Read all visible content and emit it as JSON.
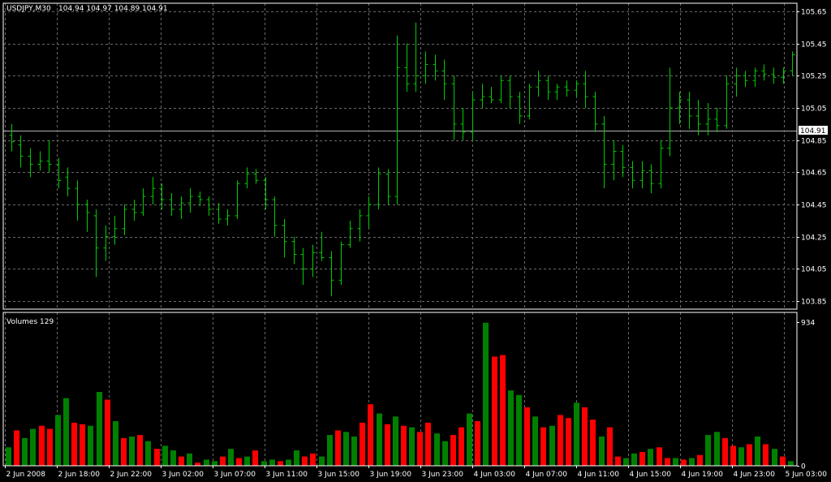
{
  "chart_data": [
    {
      "type": "ohlc",
      "title": "USDJPY,M30",
      "ohlc_header": "104.94 104.97 104.89 104.91",
      "current_price": 104.91,
      "current_price_label": "104.91",
      "ylim": [
        103.8,
        105.7
      ],
      "y_ticks": [
        "105.65",
        "105.45",
        "105.25",
        "105.05",
        "104.85",
        "104.65",
        "104.45",
        "104.25",
        "104.05",
        "103.85"
      ],
      "grid": true,
      "bar_color": "#00cc00",
      "bars": [
        {
          "o": 104.88,
          "h": 104.95,
          "l": 104.78,
          "c": 104.84
        },
        {
          "o": 104.82,
          "h": 104.88,
          "l": 104.68,
          "c": 104.75
        },
        {
          "o": 104.75,
          "h": 104.8,
          "l": 104.62,
          "c": 104.7
        },
        {
          "o": 104.7,
          "h": 104.78,
          "l": 104.66,
          "c": 104.72
        },
        {
          "o": 104.72,
          "h": 104.85,
          "l": 104.65,
          "c": 104.7
        },
        {
          "o": 104.7,
          "h": 104.74,
          "l": 104.55,
          "c": 104.6
        },
        {
          "o": 104.62,
          "h": 104.68,
          "l": 104.5,
          "c": 104.55
        },
        {
          "o": 104.55,
          "h": 104.6,
          "l": 104.35,
          "c": 104.45
        },
        {
          "o": 104.45,
          "h": 104.48,
          "l": 104.28,
          "c": 104.4
        },
        {
          "o": 104.38,
          "h": 104.42,
          "l": 104.0,
          "c": 104.18
        },
        {
          "o": 104.18,
          "h": 104.32,
          "l": 104.1,
          "c": 104.25
        },
        {
          "o": 104.25,
          "h": 104.38,
          "l": 104.2,
          "c": 104.3
        },
        {
          "o": 104.3,
          "h": 104.45,
          "l": 104.26,
          "c": 104.42
        },
        {
          "o": 104.42,
          "h": 104.48,
          "l": 104.35,
          "c": 104.4
        },
        {
          "o": 104.4,
          "h": 104.55,
          "l": 104.38,
          "c": 104.5
        },
        {
          "o": 104.5,
          "h": 104.62,
          "l": 104.45,
          "c": 104.55
        },
        {
          "o": 104.55,
          "h": 104.58,
          "l": 104.42,
          "c": 104.48
        },
        {
          "o": 104.48,
          "h": 104.52,
          "l": 104.38,
          "c": 104.42
        },
        {
          "o": 104.42,
          "h": 104.5,
          "l": 104.36,
          "c": 104.46
        },
        {
          "o": 104.46,
          "h": 104.55,
          "l": 104.4,
          "c": 104.5
        },
        {
          "o": 104.5,
          "h": 104.53,
          "l": 104.44,
          "c": 104.48
        },
        {
          "o": 104.48,
          "h": 104.5,
          "l": 104.38,
          "c": 104.42
        },
        {
          "o": 104.42,
          "h": 104.46,
          "l": 104.33,
          "c": 104.36
        },
        {
          "o": 104.36,
          "h": 104.42,
          "l": 104.32,
          "c": 104.38
        },
        {
          "o": 104.38,
          "h": 104.6,
          "l": 104.36,
          "c": 104.58
        },
        {
          "o": 104.58,
          "h": 104.68,
          "l": 104.55,
          "c": 104.64
        },
        {
          "o": 104.64,
          "h": 104.67,
          "l": 104.58,
          "c": 104.6
        },
        {
          "o": 104.6,
          "h": 104.62,
          "l": 104.42,
          "c": 104.48
        },
        {
          "o": 104.48,
          "h": 104.5,
          "l": 104.25,
          "c": 104.32
        },
        {
          "o": 104.32,
          "h": 104.36,
          "l": 104.12,
          "c": 104.22
        },
        {
          "o": 104.22,
          "h": 104.25,
          "l": 104.08,
          "c": 104.14
        },
        {
          "o": 104.14,
          "h": 104.18,
          "l": 103.95,
          "c": 104.05
        },
        {
          "o": 104.05,
          "h": 104.2,
          "l": 104.0,
          "c": 104.15
        },
        {
          "o": 104.15,
          "h": 104.28,
          "l": 104.1,
          "c": 104.12
        },
        {
          "o": 104.12,
          "h": 104.16,
          "l": 103.88,
          "c": 103.98
        },
        {
          "o": 103.98,
          "h": 104.22,
          "l": 103.95,
          "c": 104.2
        },
        {
          "o": 104.2,
          "h": 104.35,
          "l": 104.18,
          "c": 104.3
        },
        {
          "o": 104.3,
          "h": 104.42,
          "l": 104.22,
          "c": 104.38
        },
        {
          "o": 104.38,
          "h": 104.5,
          "l": 104.3,
          "c": 104.45
        },
        {
          "o": 104.45,
          "h": 104.68,
          "l": 104.42,
          "c": 104.64
        },
        {
          "o": 104.64,
          "h": 104.67,
          "l": 104.45,
          "c": 104.5
        },
        {
          "o": 104.5,
          "h": 105.5,
          "l": 104.45,
          "c": 105.3
        },
        {
          "o": 105.3,
          "h": 105.45,
          "l": 105.15,
          "c": 105.2
        },
        {
          "o": 105.2,
          "h": 105.58,
          "l": 105.15,
          "c": 105.25
        },
        {
          "o": 105.25,
          "h": 105.4,
          "l": 105.2,
          "c": 105.32
        },
        {
          "o": 105.32,
          "h": 105.38,
          "l": 105.22,
          "c": 105.28
        },
        {
          "o": 105.28,
          "h": 105.35,
          "l": 105.1,
          "c": 105.2
        },
        {
          "o": 105.2,
          "h": 105.25,
          "l": 104.85,
          "c": 104.95
        },
        {
          "o": 104.95,
          "h": 105.05,
          "l": 104.85,
          "c": 104.9
        },
        {
          "o": 104.9,
          "h": 105.15,
          "l": 104.85,
          "c": 105.1
        },
        {
          "o": 105.1,
          "h": 105.2,
          "l": 105.05,
          "c": 105.12
        },
        {
          "o": 105.12,
          "h": 105.18,
          "l": 105.08,
          "c": 105.1
        },
        {
          "o": 105.1,
          "h": 105.25,
          "l": 105.08,
          "c": 105.22
        },
        {
          "o": 105.22,
          "h": 105.25,
          "l": 105.05,
          "c": 105.12
        },
        {
          "o": 105.12,
          "h": 105.15,
          "l": 104.95,
          "c": 105.0
        },
        {
          "o": 105.0,
          "h": 105.2,
          "l": 104.98,
          "c": 105.18
        },
        {
          "o": 105.18,
          "h": 105.28,
          "l": 105.12,
          "c": 105.22
        },
        {
          "o": 105.22,
          "h": 105.25,
          "l": 105.1,
          "c": 105.15
        },
        {
          "o": 105.15,
          "h": 105.2,
          "l": 105.1,
          "c": 105.18
        },
        {
          "o": 105.18,
          "h": 105.22,
          "l": 105.12,
          "c": 105.16
        },
        {
          "o": 105.16,
          "h": 105.22,
          "l": 105.12,
          "c": 105.2
        },
        {
          "o": 105.2,
          "h": 105.28,
          "l": 105.05,
          "c": 105.12
        },
        {
          "o": 105.12,
          "h": 105.15,
          "l": 104.9,
          "c": 104.95
        },
        {
          "o": 104.95,
          "h": 105.0,
          "l": 104.55,
          "c": 104.7
        },
        {
          "o": 104.7,
          "h": 104.85,
          "l": 104.6,
          "c": 104.78
        },
        {
          "o": 104.78,
          "h": 104.82,
          "l": 104.62,
          "c": 104.68
        },
        {
          "o": 104.68,
          "h": 104.72,
          "l": 104.55,
          "c": 104.6
        },
        {
          "o": 104.6,
          "h": 104.72,
          "l": 104.55,
          "c": 104.66
        },
        {
          "o": 104.66,
          "h": 104.7,
          "l": 104.52,
          "c": 104.58
        },
        {
          "o": 104.58,
          "h": 104.85,
          "l": 104.55,
          "c": 104.8
        },
        {
          "o": 104.8,
          "h": 105.3,
          "l": 104.75,
          "c": 105.05
        },
        {
          "o": 105.05,
          "h": 105.15,
          "l": 104.95,
          "c": 105.1
        },
        {
          "o": 105.1,
          "h": 105.15,
          "l": 104.92,
          "c": 105.0
        },
        {
          "o": 105.0,
          "h": 105.1,
          "l": 104.88,
          "c": 104.95
        },
        {
          "o": 104.95,
          "h": 105.08,
          "l": 104.88,
          "c": 104.98
        },
        {
          "o": 104.98,
          "h": 105.05,
          "l": 104.9,
          "c": 104.94
        },
        {
          "o": 104.94,
          "h": 105.25,
          "l": 104.92,
          "c": 105.2
        },
        {
          "o": 105.2,
          "h": 105.3,
          "l": 105.12,
          "c": 105.25
        },
        {
          "o": 105.25,
          "h": 105.28,
          "l": 105.18,
          "c": 105.22
        },
        {
          "o": 105.22,
          "h": 105.3,
          "l": 105.18,
          "c": 105.28
        },
        {
          "o": 105.28,
          "h": 105.32,
          "l": 105.22,
          "c": 105.26
        },
        {
          "o": 105.26,
          "h": 105.3,
          "l": 105.2,
          "c": 105.24
        },
        {
          "o": 105.24,
          "h": 105.3,
          "l": 105.2,
          "c": 105.28
        },
        {
          "o": 105.28,
          "h": 105.4,
          "l": 105.25,
          "c": 105.38
        }
      ]
    },
    {
      "type": "bar",
      "title": "Volumes 129",
      "ylim": [
        0,
        934
      ],
      "y_ticks": [
        "934",
        "0"
      ],
      "up_color": "#008000",
      "down_color": "#ff0000",
      "x_tick_labels": [
        "2 Jun 2008",
        "2 Jun 18:00",
        "2 Jun 22:00",
        "3 Jun 02:00",
        "3 Jun 07:00",
        "3 Jun 11:00",
        "3 Jun 15:00",
        "3 Jun 19:00",
        "3 Jun 23:00",
        "4 Jun 03:00",
        "4 Jun 07:00",
        "4 Jun 11:00",
        "4 Jun 15:00",
        "4 Jun 19:00",
        "4 Jun 23:00",
        "5 Jun 03:00"
      ],
      "volumes": [
        120,
        230,
        180,
        240,
        260,
        240,
        330,
        440,
        280,
        270,
        260,
        480,
        430,
        290,
        180,
        190,
        200,
        160,
        110,
        130,
        100,
        60,
        80,
        20,
        40,
        30,
        60,
        110,
        50,
        60,
        100,
        30,
        40,
        30,
        40,
        100,
        60,
        80,
        60,
        200,
        230,
        220,
        190,
        280,
        400,
        340,
        270,
        320,
        260,
        250,
        220,
        280,
        210,
        160,
        200,
        250,
        340,
        290,
        930,
        710,
        720,
        490,
        460,
        380,
        320,
        250,
        260,
        330,
        310,
        410,
        380,
        300,
        190,
        250,
        60,
        50,
        80,
        90,
        110,
        120,
        50,
        50,
        40,
        50,
        70,
        200,
        220,
        180,
        130,
        120,
        140,
        190,
        140,
        110,
        60,
        30
      ],
      "volume_colors": [
        "g",
        "r",
        "g",
        "g",
        "r",
        "r",
        "g",
        "g",
        "r",
        "r",
        "g",
        "g",
        "r",
        "g",
        "r",
        "g",
        "r",
        "g",
        "r",
        "g",
        "g",
        "r",
        "g",
        "r",
        "g",
        "g",
        "r",
        "g",
        "r",
        "g",
        "r",
        "g",
        "g",
        "r",
        "g",
        "g",
        "r",
        "r",
        "g",
        "g",
        "r",
        "g",
        "g",
        "r",
        "r",
        "g",
        "r",
        "g",
        "r",
        "g",
        "r",
        "r",
        "g",
        "g",
        "r",
        "r",
        "g",
        "r",
        "g",
        "r",
        "r",
        "g",
        "g",
        "r",
        "g",
        "r",
        "g",
        "r",
        "r",
        "g",
        "r",
        "r",
        "g",
        "r",
        "r",
        "g",
        "g",
        "r",
        "g",
        "r",
        "r",
        "g",
        "r",
        "g",
        "r",
        "g",
        "g",
        "r",
        "r",
        "g",
        "r",
        "g",
        "r",
        "g",
        "r",
        "g"
      ]
    }
  ]
}
